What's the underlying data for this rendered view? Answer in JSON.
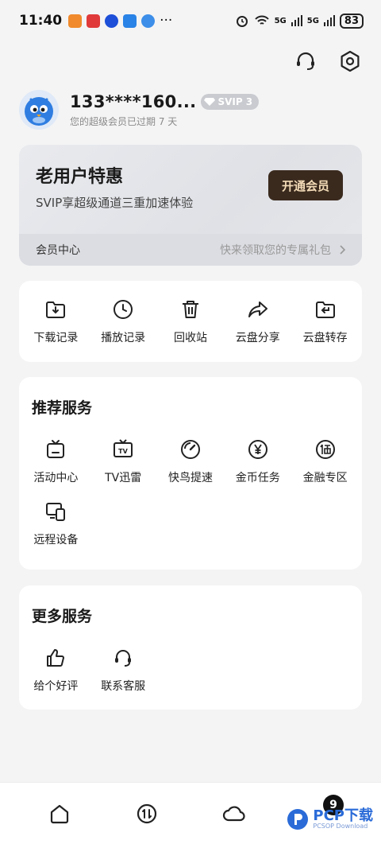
{
  "status_bar": {
    "time": "11:40",
    "more": "···",
    "signal_1": "5G",
    "signal_2": "5G",
    "battery": "83"
  },
  "profile": {
    "name": "133****160...",
    "badge": "SVIP 3",
    "subtitle": "您的超级会员已过期 7 天"
  },
  "vip_card": {
    "title": "老用户特惠",
    "desc": "SVIP享超级通道三重加速体验",
    "button": "开通会员",
    "footer_left": "会员中心",
    "footer_right": "快来领取您的专属礼包"
  },
  "quick_actions": [
    {
      "label": "下载记录",
      "icon": "download-folder-icon"
    },
    {
      "label": "播放记录",
      "icon": "clock-icon"
    },
    {
      "label": "回收站",
      "icon": "trash-icon"
    },
    {
      "label": "云盘分享",
      "icon": "share-icon"
    },
    {
      "label": "云盘转存",
      "icon": "folder-return-icon"
    }
  ],
  "recommended": {
    "title": "推荐服务",
    "items": [
      {
        "label": "活动中心",
        "icon": "tv-box-icon"
      },
      {
        "label": "TV迅雷",
        "icon": "tv-icon"
      },
      {
        "label": "快鸟提速",
        "icon": "speedometer-icon"
      },
      {
        "label": "金币任务",
        "icon": "yen-coin-icon"
      },
      {
        "label": "金融专区",
        "icon": "borrow-icon"
      },
      {
        "label": "远程设备",
        "icon": "devices-icon"
      }
    ]
  },
  "more_services": {
    "title": "更多服务",
    "items": [
      {
        "label": "给个好评",
        "icon": "thumbs-up-icon"
      },
      {
        "label": "联系客服",
        "icon": "headset-icon"
      }
    ]
  },
  "tabbar": {
    "badge_count": "9",
    "watermark": "PCP下载",
    "watermark_sub": "PCSOP Download"
  },
  "colors": {
    "background": "#f4f4f5",
    "vip_button_bg": "#3a2a1e",
    "vip_button_text": "#f4dcb8",
    "avatar_blue": "#2f7de1"
  }
}
